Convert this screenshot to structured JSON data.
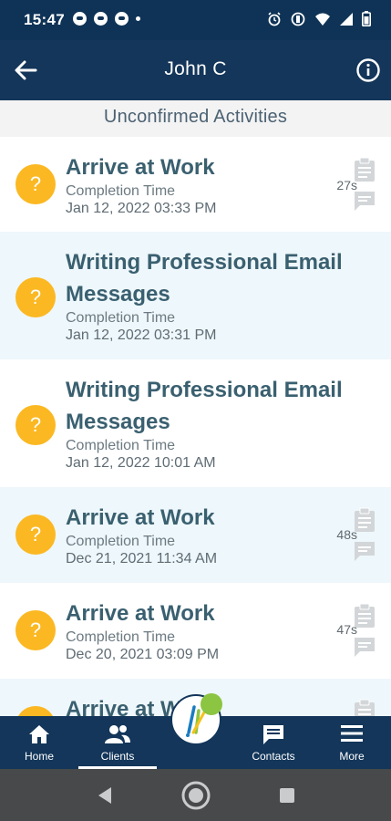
{
  "status_bar": {
    "time": "15:47",
    "left_icons": [
      "notification-icon",
      "notification-icon",
      "notification-icon",
      "dot-icon"
    ],
    "right_icons": [
      "alarm-icon",
      "vibrate-icon",
      "wifi-icon",
      "signal-icon",
      "battery-icon"
    ]
  },
  "header": {
    "title": "John C",
    "background": "#13365a"
  },
  "subheader": {
    "title": "Unconfirmed Activities"
  },
  "activities": [
    {
      "status_symbol": "?",
      "title_lines": [
        "Arrive at Work"
      ],
      "label": "Completion Time",
      "date": "Jan 12, 2022 03:33 PM",
      "duration": "27s",
      "has_icons": true
    },
    {
      "status_symbol": "?",
      "title_lines": [
        "Writing Professional Email",
        "Messages"
      ],
      "label": "Completion Time",
      "date": "Jan 12, 2022 03:31 PM",
      "duration": "",
      "has_icons": false
    },
    {
      "status_symbol": "?",
      "title_lines": [
        "Writing Professional Email",
        "Messages"
      ],
      "label": "Completion Time",
      "date": "Jan 12, 2022 10:01 AM",
      "duration": "",
      "has_icons": false
    },
    {
      "status_symbol": "?",
      "title_lines": [
        "Arrive at Work"
      ],
      "label": "Completion Time",
      "date": "Dec 21, 2021 11:34 AM",
      "duration": "48s",
      "has_icons": true
    },
    {
      "status_symbol": "?",
      "title_lines": [
        "Arrive at Work"
      ],
      "label": "Completion Time",
      "date": "Dec 20, 2021 03:09 PM",
      "duration": "47s",
      "has_icons": true
    },
    {
      "status_symbol": "?",
      "title_lines": [
        "Arrive at Work"
      ],
      "label": "",
      "date": "",
      "duration": "",
      "has_icons": true
    }
  ],
  "bottom_nav": {
    "items": [
      {
        "label": "Home",
        "icon": "home-icon"
      },
      {
        "label": "Clients",
        "icon": "clients-icon",
        "active": true
      },
      {
        "label": "Contacts",
        "icon": "contacts-icon"
      },
      {
        "label": "More",
        "icon": "menu-icon"
      }
    ],
    "center_icon": "app-logo-icon"
  },
  "colors": {
    "primary": "#13365a",
    "status_pending": "#fbb822",
    "title_text": "#3a6070",
    "alt_row": "#eef7fb",
    "logo_accent": "#8cc541"
  }
}
